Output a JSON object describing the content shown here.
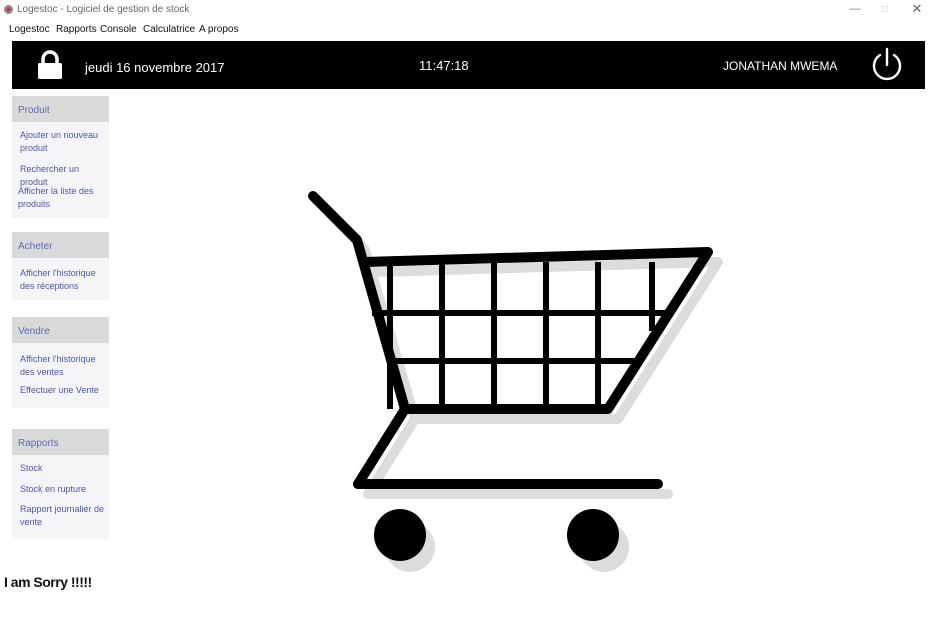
{
  "window": {
    "title": "Logestoc - Logiciel de gestion de stock",
    "minimize_glyph": "—",
    "maximize_glyph": "□",
    "close_glyph": "✕"
  },
  "menu": {
    "items": [
      {
        "label": "Logestoc"
      },
      {
        "label": "Rapports"
      },
      {
        "label": "Console"
      },
      {
        "label": "Calculatrice"
      },
      {
        "label": "A propos"
      }
    ]
  },
  "header": {
    "date": "jeudi 16 novembre 2017",
    "time": "11:47:18",
    "user": "JONATHAN MWEMA",
    "background_color": "#000000",
    "lock_icon": "lock-icon",
    "power_icon": "power-icon"
  },
  "sidebar": {
    "sections": [
      {
        "title": "Produit",
        "items": [
          {
            "label": "Ajouter un nouveau produit"
          },
          {
            "label": "Rechercher un produit"
          },
          {
            "label": "Afficher la liste des produits"
          }
        ]
      },
      {
        "title": "Acheter",
        "items": [
          {
            "label": "Afficher l'historique des réceptions"
          }
        ]
      },
      {
        "title": "Vendre",
        "items": [
          {
            "label": "Afficher l'historique des ventes"
          },
          {
            "label": "Effectuer une Vente"
          }
        ]
      },
      {
        "title": "Rapports",
        "items": [
          {
            "label": "Stock"
          },
          {
            "label": "Stock en rupture"
          },
          {
            "label": "Rapport journalier de vente"
          }
        ]
      }
    ],
    "link_color": "#4a58b0",
    "header_text_color": "#5b6bb8"
  },
  "main": {
    "illustration": "shopping-cart-icon"
  },
  "caption": {
    "text": "I am Sorry !!!!!"
  }
}
